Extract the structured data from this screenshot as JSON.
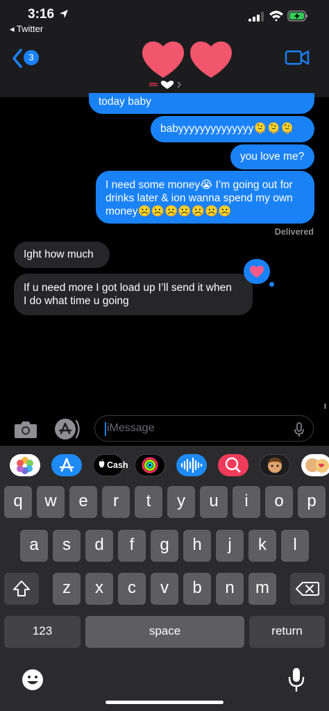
{
  "status_bar": {
    "time": "3:16",
    "back_app": "◂ Twitter",
    "battery_color": "#34c759"
  },
  "nav": {
    "unread_count": "3",
    "contact_label": "❤️🤍",
    "accent": "#1a82f7"
  },
  "messages": [
    {
      "from": "me",
      "text": "today baby"
    },
    {
      "from": "me",
      "text": "babyyyyyyyyyyyyyy🫠🫠🫠"
    },
    {
      "from": "me",
      "text": "you love me?"
    },
    {
      "from": "me",
      "lines": [
        "I need some money😭 I’m going out for",
        "drinks later & ion wanna spend my own",
        "money☹️☹️☹️☹️☹️☹️☹️"
      ]
    },
    {
      "from": "them",
      "text": "Ight how much"
    },
    {
      "from": "them",
      "lines": [
        "If u need more I got load up I’ll send it when",
        "I do what time u going"
      ]
    }
  ],
  "delivered_label": "Delivered",
  "composer": {
    "placeholder": "iMessage"
  },
  "app_drawer": [
    {
      "name": "photos",
      "label": ""
    },
    {
      "name": "app-store",
      "label": ""
    },
    {
      "name": "apple-cash",
      "label": "Cash"
    },
    {
      "name": "activity",
      "label": ""
    },
    {
      "name": "audio-message",
      "label": ""
    },
    {
      "name": "images-search",
      "label": ""
    },
    {
      "name": "memoji",
      "label": ""
    },
    {
      "name": "memoji-stickers",
      "label": ""
    }
  ],
  "keyboard": {
    "row1": [
      "q",
      "w",
      "e",
      "r",
      "t",
      "y",
      "u",
      "i",
      "o",
      "p"
    ],
    "row2": [
      "a",
      "s",
      "d",
      "f",
      "g",
      "h",
      "j",
      "k",
      "l"
    ],
    "row3": [
      "z",
      "x",
      "c",
      "v",
      "b",
      "n",
      "m"
    ],
    "numbers_label": "123",
    "space_label": "space",
    "return_label": "return"
  }
}
